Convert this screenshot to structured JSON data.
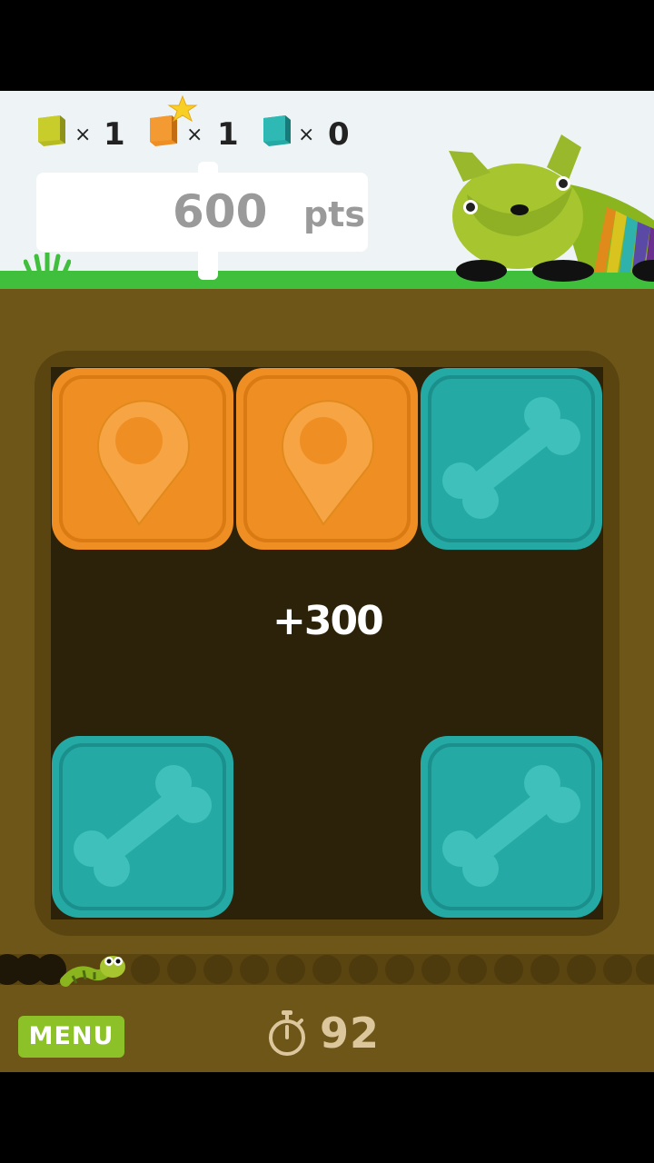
{
  "hud": {
    "counters": [
      {
        "color": "#b7bb22",
        "x_label": "×",
        "count": "1",
        "icon": "yellow-block-icon"
      },
      {
        "color": "#ef8f23",
        "x_label": "×",
        "count": "1",
        "icon": "orange-star-block-icon"
      },
      {
        "color": "#24a9a5",
        "x_label": "×",
        "count": "0",
        "icon": "teal-block-icon"
      }
    ],
    "score_value": "600",
    "score_unit": "pts"
  },
  "board": {
    "tiles": [
      {
        "type": "orange",
        "icon": "map-pin-icon"
      },
      {
        "type": "orange",
        "icon": "map-pin-icon"
      },
      {
        "type": "teal",
        "icon": "bone-icon"
      },
      {
        "type": "teal",
        "icon": "bone-icon"
      },
      {
        "type": "teal",
        "icon": "bone-icon"
      }
    ],
    "score_popup": "+300"
  },
  "footer": {
    "menu_label": "MENU",
    "timer_value": "92",
    "timer_icon": "stopwatch-icon"
  },
  "colors": {
    "sky": "#eef4f5",
    "grass": "#3fbf3c",
    "ground": "#6e5518",
    "board": "#2b2209",
    "orange_tile": "#ef8f23",
    "teal_tile": "#24a9a5",
    "menu_button": "#8cc128"
  }
}
